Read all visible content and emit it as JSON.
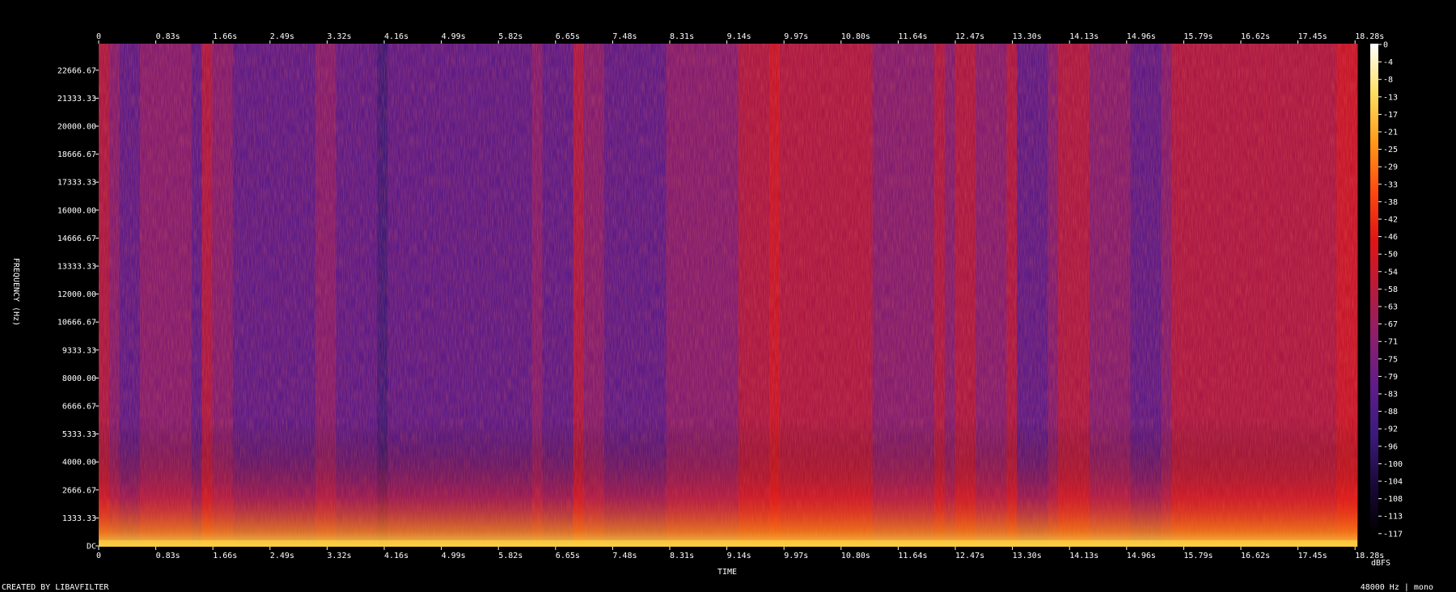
{
  "chart_data": {
    "type": "heatmap",
    "title": "",
    "xlabel": "TIME",
    "ylabel": "FREQUENCY (Hz)",
    "x_ticks": [
      "0",
      "0.83s",
      "1.66s",
      "2.49s",
      "3.32s",
      "4.16s",
      "4.99s",
      "5.82s",
      "6.65s",
      "7.48s",
      "8.31s",
      "9.14s",
      "9.97s",
      "10.80s",
      "11.64s",
      "12.47s",
      "13.30s",
      "14.13s",
      "14.96s",
      "15.79s",
      "16.62s",
      "17.45s",
      "18.28s"
    ],
    "y_ticks": [
      "DC",
      "1333.33",
      "2666.67",
      "4000.00",
      "5333.33",
      "6666.67",
      "8000.00",
      "9333.33",
      "10666.67",
      "12000.00",
      "13333.33",
      "14666.67",
      "16000.00",
      "17333.33",
      "18666.67",
      "20000.00",
      "21333.33",
      "22666.67"
    ],
    "xlim": [
      0,
      19.1
    ],
    "ylim": [
      0,
      24000
    ],
    "colorbar": {
      "label": "dBFS",
      "ticks": [
        "0",
        "-4",
        "-8",
        "-13",
        "-17",
        "-21",
        "-25",
        "-29",
        "-33",
        "-38",
        "-42",
        "-46",
        "-50",
        "-54",
        "-58",
        "-63",
        "-67",
        "-71",
        "-75",
        "-79",
        "-83",
        "-88",
        "-92",
        "-96",
        "-100",
        "-104",
        "-108",
        "-113",
        "-117"
      ]
    },
    "colormap": [
      "#000000",
      "#1a0838",
      "#3a1a7a",
      "#5e1c8a",
      "#8a1f6e",
      "#b81a3c",
      "#e01414",
      "#ff4a10",
      "#ff9a18",
      "#ffe060",
      "#ffffff"
    ],
    "footer_left": "CREATED BY LIBAVFILTER",
    "footer_right": "48000 Hz | mono",
    "column_loudness": [
      0.55,
      0.35,
      0.3,
      0.25,
      0.4,
      0.42,
      0.45,
      0.4,
      0.38,
      0.32,
      0.5,
      0.42,
      0.34,
      0.28,
      0.2,
      0.18,
      0.22,
      0.2,
      0.22,
      0.25,
      0.3,
      0.38,
      0.35,
      0.3,
      0.28,
      0.22,
      0.18,
      0.15,
      0.28,
      0.33,
      0.3,
      0.33,
      0.32,
      0.28,
      0.3,
      0.32,
      0.3,
      0.26,
      0.24,
      0.22,
      0.2,
      0.3,
      0.34,
      0.28,
      0.22,
      0.3,
      0.5,
      0.45,
      0.35,
      0.3,
      0.25,
      0.2,
      0.22,
      0.18,
      0.22,
      0.4,
      0.42,
      0.45,
      0.45,
      0.4,
      0.35,
      0.4,
      0.5,
      0.55,
      0.6,
      0.7,
      0.65,
      0.6,
      0.62,
      0.55,
      0.52,
      0.55,
      0.58,
      0.5,
      0.52,
      0.48,
      0.4,
      0.42,
      0.45,
      0.38,
      0.42,
      0.5,
      0.45,
      0.5,
      0.52,
      0.48,
      0.4,
      0.45,
      0.52,
      0.3,
      0.25,
      0.3,
      0.45,
      0.52,
      0.55,
      0.5,
      0.48,
      0.45,
      0.42,
      0.35,
      0.25,
      0.3,
      0.25,
      0.45,
      0.6,
      0.62,
      0.6,
      0.58,
      0.6,
      0.55,
      0.52,
      0.55,
      0.6,
      0.65,
      0.62,
      0.6,
      0.55,
      0.6,
      0.62,
      0.65,
      0.7,
      0.75
    ]
  }
}
